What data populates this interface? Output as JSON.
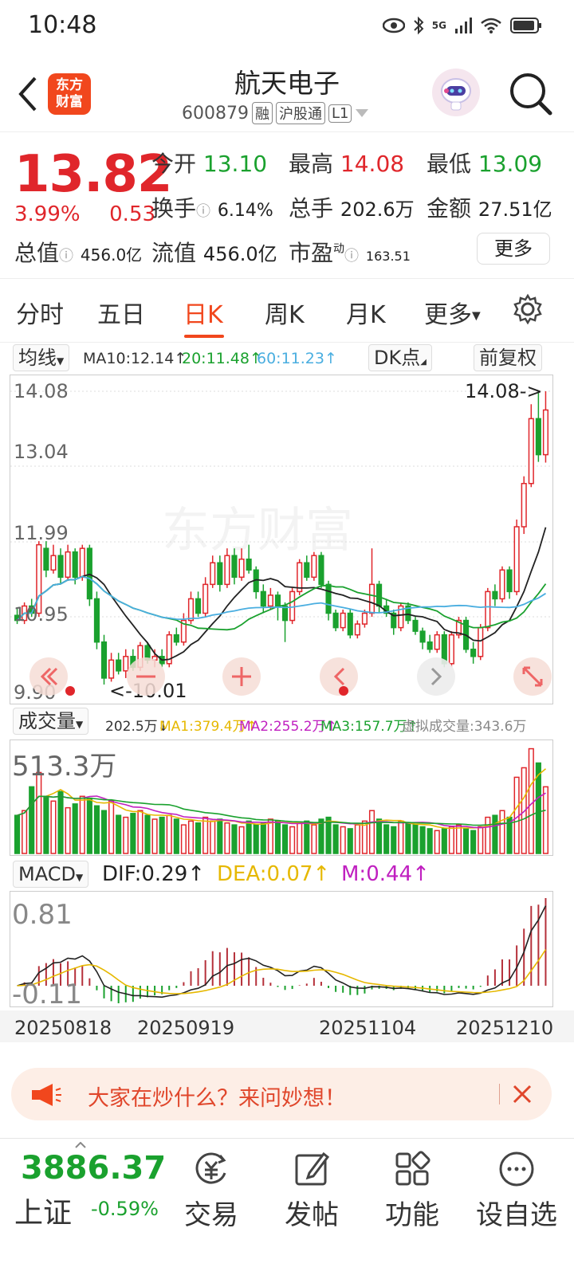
{
  "status": {
    "time": "10:48",
    "net": "5G"
  },
  "header": {
    "name": "航天电子",
    "code": "600879",
    "tags": [
      "融",
      "沪股通",
      "L1"
    ],
    "logo_text": "东方财富"
  },
  "quote": {
    "price": "13.82",
    "change_pct": "3.99%",
    "change": "0.53",
    "open_label": "今开",
    "open": "13.10",
    "high_label": "最高",
    "high": "14.08",
    "low_label": "最低",
    "low": "13.09",
    "turnover_label": "换手",
    "turnover": "6.14%",
    "vol_label": "总手",
    "vol": "202.6万",
    "amount_label": "金额",
    "amount": "27.51亿",
    "mktcap_label": "总值",
    "mktcap": "456.0亿",
    "float_label": "流值",
    "float": "456.0亿",
    "pe_label": "市盈",
    "pe_sup": "动",
    "pe": "163.51",
    "more": "更多"
  },
  "tabs": [
    "分时",
    "五日",
    "日K",
    "周K",
    "月K",
    "更多"
  ],
  "active_tab": "日K",
  "ma": {
    "sel": "均线",
    "ma10": "MA10:12.14↑",
    "ma20": "20:11.48↑",
    "ma60": "60:11.23↑",
    "dk": "DK点",
    "fq": "前复权"
  },
  "kline": {
    "y_labels": [
      "14.08",
      "13.04",
      "11.99",
      "10.95",
      "9.90"
    ],
    "high_mark": "14.08->",
    "low_mark": "<-10.01",
    "watermark": "东方财富"
  },
  "volume": {
    "sel": "成交量",
    "cur": "202.5万↓",
    "ma1": "MA1:379.4万↑",
    "ma2": "MA2:255.2万↑",
    "ma3": "MA3:157.7万↑",
    "virtual": "虚拟成交量:343.6万",
    "max": "513.3万"
  },
  "macd": {
    "sel": "MACD",
    "dif": "DIF:0.29↑",
    "dea": "DEA:0.07↑",
    "m": "M:0.44↑",
    "top": "0.81",
    "bottom": "-0.11"
  },
  "dates": [
    "20250818",
    "20250919",
    "20251104",
    "20251210"
  ],
  "banner": {
    "text": "大家在炒什么？来问妙想！"
  },
  "bottom": {
    "index_value": "3886.37",
    "index_name": "上证",
    "index_chg": "-0.59%",
    "nav": [
      "交易",
      "发帖",
      "功能",
      "设自选"
    ]
  },
  "colors": {
    "up": "#e0262b",
    "down": "#1aa12e",
    "accent": "#f1471d"
  },
  "candles": [
    [
      10.97,
      10.9,
      11.08,
      10.85
    ],
    [
      10.9,
      11.1,
      11.15,
      10.85
    ],
    [
      11.1,
      11.0,
      11.2,
      10.95
    ],
    [
      11.0,
      11.95,
      12.0,
      10.95
    ],
    [
      11.9,
      11.6,
      12.0,
      11.5
    ],
    [
      11.6,
      11.8,
      11.95,
      11.55
    ],
    [
      11.8,
      11.5,
      11.9,
      11.4
    ],
    [
      11.5,
      11.85,
      11.95,
      11.45
    ],
    [
      11.85,
      11.5,
      11.9,
      11.4
    ],
    [
      11.5,
      11.9,
      11.95,
      11.45
    ],
    [
      11.9,
      11.2,
      11.95,
      11.1
    ],
    [
      11.2,
      10.6,
      11.3,
      10.5
    ],
    [
      10.6,
      10.1,
      10.7,
      10.01
    ],
    [
      10.1,
      10.35,
      10.45,
      10.05
    ],
    [
      10.35,
      10.2,
      10.45,
      10.15
    ],
    [
      10.2,
      10.4,
      10.5,
      10.1
    ],
    [
      10.4,
      10.25,
      10.5,
      10.2
    ],
    [
      10.25,
      10.55,
      10.6,
      10.2
    ],
    [
      10.55,
      10.35,
      10.6,
      10.3
    ],
    [
      10.35,
      10.4,
      10.5,
      10.25
    ],
    [
      10.4,
      10.3,
      10.5,
      10.25
    ],
    [
      10.3,
      10.7,
      10.75,
      10.25
    ],
    [
      10.7,
      10.6,
      10.8,
      10.55
    ],
    [
      10.6,
      10.9,
      11.0,
      10.55
    ],
    [
      10.9,
      11.2,
      11.3,
      10.85
    ],
    [
      11.2,
      11.0,
      11.3,
      10.95
    ],
    [
      11.0,
      11.4,
      11.5,
      10.95
    ],
    [
      11.4,
      11.7,
      11.8,
      11.35
    ],
    [
      11.7,
      11.4,
      11.8,
      11.3
    ],
    [
      11.4,
      11.8,
      11.9,
      11.35
    ],
    [
      11.8,
      11.5,
      11.9,
      11.4
    ],
    [
      11.5,
      11.75,
      11.9,
      11.45
    ],
    [
      11.75,
      11.6,
      11.95,
      11.55
    ],
    [
      11.6,
      11.3,
      11.65,
      11.2
    ],
    [
      11.3,
      11.1,
      11.4,
      11.0
    ],
    [
      11.1,
      11.25,
      11.35,
      11.05
    ],
    [
      11.25,
      11.1,
      11.3,
      10.9
    ],
    [
      11.1,
      10.9,
      11.15,
      10.6
    ],
    [
      10.9,
      11.3,
      11.35,
      10.85
    ],
    [
      11.3,
      11.7,
      11.75,
      11.25
    ],
    [
      11.7,
      11.5,
      11.8,
      11.45
    ],
    [
      11.5,
      11.8,
      11.85,
      11.45
    ],
    [
      11.8,
      11.4,
      11.85,
      11.35
    ],
    [
      11.4,
      11.0,
      11.45,
      10.9
    ],
    [
      11.0,
      10.8,
      11.05,
      10.75
    ],
    [
      10.8,
      11.0,
      11.05,
      10.75
    ],
    [
      11.0,
      10.7,
      11.05,
      10.65
    ],
    [
      10.7,
      10.85,
      10.9,
      10.65
    ],
    [
      10.85,
      11.0,
      11.05,
      10.8
    ],
    [
      11.0,
      11.4,
      11.9,
      10.95
    ],
    [
      11.4,
      11.1,
      11.45,
      11.0
    ],
    [
      11.1,
      11.0,
      11.2,
      10.95
    ],
    [
      11.0,
      10.8,
      11.05,
      10.7
    ],
    [
      10.8,
      11.1,
      11.15,
      10.75
    ],
    [
      11.1,
      10.9,
      11.15,
      10.85
    ],
    [
      10.9,
      10.75,
      10.95,
      10.7
    ],
    [
      10.75,
      10.6,
      10.8,
      10.5
    ],
    [
      10.6,
      10.5,
      10.7,
      10.45
    ],
    [
      10.5,
      10.7,
      10.75,
      10.45
    ],
    [
      10.7,
      10.3,
      10.75,
      10.25
    ],
    [
      10.3,
      10.7,
      10.75,
      10.25
    ],
    [
      10.7,
      10.9,
      10.95,
      10.65
    ],
    [
      10.9,
      10.5,
      10.95,
      10.45
    ],
    [
      10.5,
      10.4,
      10.6,
      10.3
    ],
    [
      10.4,
      10.8,
      10.85,
      10.35
    ],
    [
      10.8,
      11.3,
      11.35,
      10.75
    ],
    [
      11.3,
      11.2,
      11.4,
      11.1
    ],
    [
      11.2,
      11.6,
      11.65,
      11.15
    ],
    [
      11.6,
      11.3,
      11.65,
      11.2
    ],
    [
      11.3,
      12.2,
      12.3,
      11.25
    ],
    [
      12.2,
      12.8,
      12.9,
      12.1
    ],
    [
      12.8,
      13.7,
      13.9,
      12.75
    ],
    [
      13.7,
      13.2,
      14.08,
      13.1
    ],
    [
      13.2,
      13.82,
      14.08,
      13.09
    ]
  ],
  "vol": [
    40,
    45,
    70,
    85,
    60,
    55,
    65,
    48,
    52,
    60,
    58,
    50,
    45,
    55,
    40,
    38,
    42,
    45,
    40,
    36,
    38,
    40,
    36,
    30,
    34,
    32,
    38,
    34,
    36,
    32,
    30,
    28,
    34,
    30,
    32,
    36,
    34,
    30,
    28,
    32,
    34,
    30,
    36,
    38,
    30,
    28,
    26,
    30,
    34,
    45,
    36,
    30,
    28,
    34,
    32,
    30,
    28,
    26,
    24,
    26,
    28,
    30,
    26,
    24,
    28,
    38,
    40,
    45,
    38,
    80,
    90,
    110,
    95,
    70
  ]
}
